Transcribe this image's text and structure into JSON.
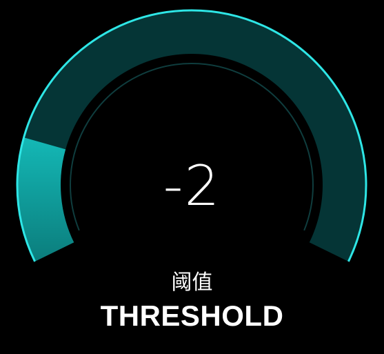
{
  "gauge": {
    "value_display": "-2",
    "label_cn": "阈值",
    "label_en": "THRESHOLD",
    "level_fraction": 0.18
  },
  "colors": {
    "background": "#000000",
    "track": "#053536",
    "fill_light": "#14b8b6",
    "fill_dark": "#0b7d7c",
    "outline": "#2ee6e6",
    "inner_ring": "#0f3d3e",
    "text": "#ffffff"
  }
}
